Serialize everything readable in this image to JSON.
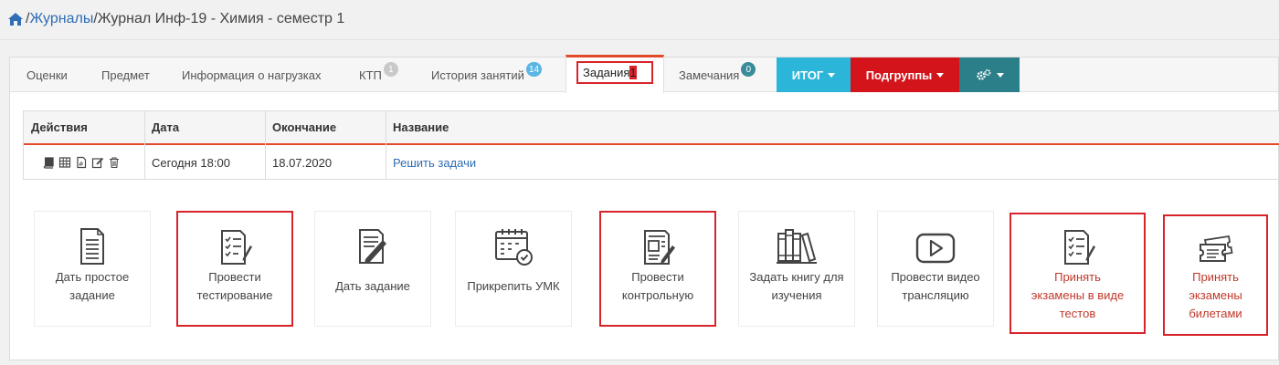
{
  "breadcrumb": {
    "sep1": "/",
    "link": "Журналы",
    "sep2": "/",
    "current": "Журнал Инф-19 - Химия - семестр 1"
  },
  "tabs": [
    {
      "label": "Оценки"
    },
    {
      "label": "Предмет"
    },
    {
      "label": "Информация о нагрузках"
    },
    {
      "label": "КТП",
      "badge": "1"
    },
    {
      "label": "История занятий",
      "badge": "14"
    },
    {
      "label": "Задания",
      "badge": "1",
      "active": true
    },
    {
      "label": "Замечания",
      "badge": "0"
    }
  ],
  "dropdowns": [
    {
      "label": "ИТОГ",
      "color": "#2bb6d9"
    },
    {
      "label": "Подгруппы",
      "color": "#d4141b"
    },
    {
      "label": "",
      "color": "#2b7f89"
    }
  ],
  "table": {
    "headers": [
      "Действия",
      "Дата",
      "Окончание",
      "Название"
    ],
    "rows": [
      {
        "date": "Сегодня 18:00",
        "end": "18.07.2020",
        "name": "Решить задачи"
      }
    ]
  },
  "cards": [
    {
      "line1": "Дать простое",
      "line2": "задание",
      "icon": "document-lines-icon"
    },
    {
      "line1": "Провести",
      "line2": "тестирование",
      "icon": "test-checklist-icon",
      "highlighted": true
    },
    {
      "line1": "Дать задание",
      "icon": "document-pen-icon"
    },
    {
      "line1": "Прикрепить УМК",
      "icon": "calendar-check-icon"
    },
    {
      "line1": "Провести",
      "line2": "контрольную",
      "icon": "exam-sheet-icon",
      "highlighted": true
    },
    {
      "line1": "Задать книгу для",
      "line2": "изучения",
      "icon": "books-icon"
    },
    {
      "line1": "Провести видео",
      "line2": "трансляцию",
      "icon": "video-play-icon"
    },
    {
      "line1": "Принять",
      "line2": "экзамены в виде",
      "line3": "тестов",
      "icon": "test-checklist-icon",
      "highlighted": true,
      "red": true
    },
    {
      "line1": "Принять",
      "line2": "экзамены",
      "line3": "билетами",
      "icon": "tickets-icon",
      "highlighted": true,
      "red": true
    }
  ],
  "colors": {
    "accent": "#e24a2c",
    "highlight": "#d9232a",
    "link": "#2f6db5"
  }
}
